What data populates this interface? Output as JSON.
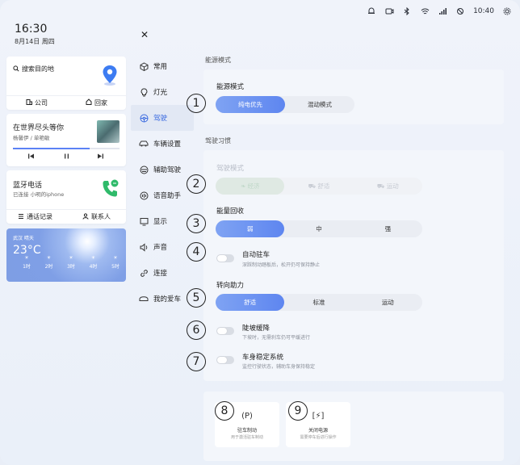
{
  "status_bar": {
    "time": "10:40",
    "icons": [
      "alarm-icon",
      "camera-icon",
      "bluetooth-icon",
      "wifi-icon",
      "signal-icon",
      "no-sound-icon",
      "settings-gear-icon"
    ]
  },
  "left": {
    "clock": {
      "time": "16:30",
      "date": "8月14日 周四"
    },
    "navigation": {
      "search_label": "搜索目的地",
      "company_label": "公司",
      "home_label": "回家"
    },
    "music": {
      "title": "在世界尽头等你",
      "artist": "杨馨伊 / 单艳敏",
      "progress": 0.72
    },
    "phone": {
      "title": "蓝牙电话",
      "sub": "已连接 小明的iphone",
      "call_log_label": "通话记录",
      "contacts_label": "联系人"
    },
    "weather": {
      "location": "武汉 晴天",
      "temp": "23°C",
      "hours": [
        "1时",
        "2时",
        "3时",
        "4时",
        "5时"
      ]
    }
  },
  "menu": {
    "items": [
      {
        "label": "常用",
        "icon": "cube-icon"
      },
      {
        "label": "灯光",
        "icon": "bulb-icon"
      },
      {
        "label": "驾驶",
        "icon": "steering-icon",
        "active": true
      },
      {
        "label": "车辆设置",
        "icon": "car-icon"
      },
      {
        "label": "辅助驾驶",
        "icon": "assist-icon"
      },
      {
        "label": "语音助手",
        "icon": "voice-icon"
      },
      {
        "label": "显示",
        "icon": "display-icon"
      },
      {
        "label": "声音",
        "icon": "speaker-icon"
      },
      {
        "label": "连接",
        "icon": "link-icon"
      },
      {
        "label": "我的爱车",
        "icon": "my-car-icon"
      }
    ]
  },
  "content": {
    "energy_section_label": "能源模式",
    "energy": {
      "label": "能源模式",
      "options": [
        "纯电优先",
        "混动模式"
      ],
      "selected": 0
    },
    "habit_section_label": "驾驶习惯",
    "drive_mode": {
      "label": "驾驶模式",
      "options": [
        "经济",
        "舒适",
        "运动"
      ],
      "selected": 0
    },
    "regen": {
      "label": "能量回收",
      "options": [
        "弱",
        "中",
        "强"
      ],
      "selected": 0
    },
    "auto_hold": {
      "title": "自动驻车",
      "desc": "深踩制动踏板后，松开仍可保持静止"
    },
    "steering": {
      "label": "转向助力",
      "options": [
        "舒适",
        "标准",
        "运动"
      ],
      "selected": 0
    },
    "hill_descent": {
      "title": "陡坡缓降",
      "desc": "下坡时，无需刹车仍可平缓进行"
    },
    "esc": {
      "title": "车身稳定系统",
      "desc": "监控行驶状态，辅助车身保持稳定"
    },
    "tiles": [
      {
        "title": "驻车制动",
        "desc": "用于激活驻车制动",
        "icon": "(P)"
      },
      {
        "title": "关闭电源",
        "desc": "需要停车后进行操作",
        "icon": "[⚡]"
      }
    ]
  },
  "annotations": [
    "1",
    "2",
    "3",
    "4",
    "5",
    "6",
    "7",
    "8",
    "9"
  ]
}
